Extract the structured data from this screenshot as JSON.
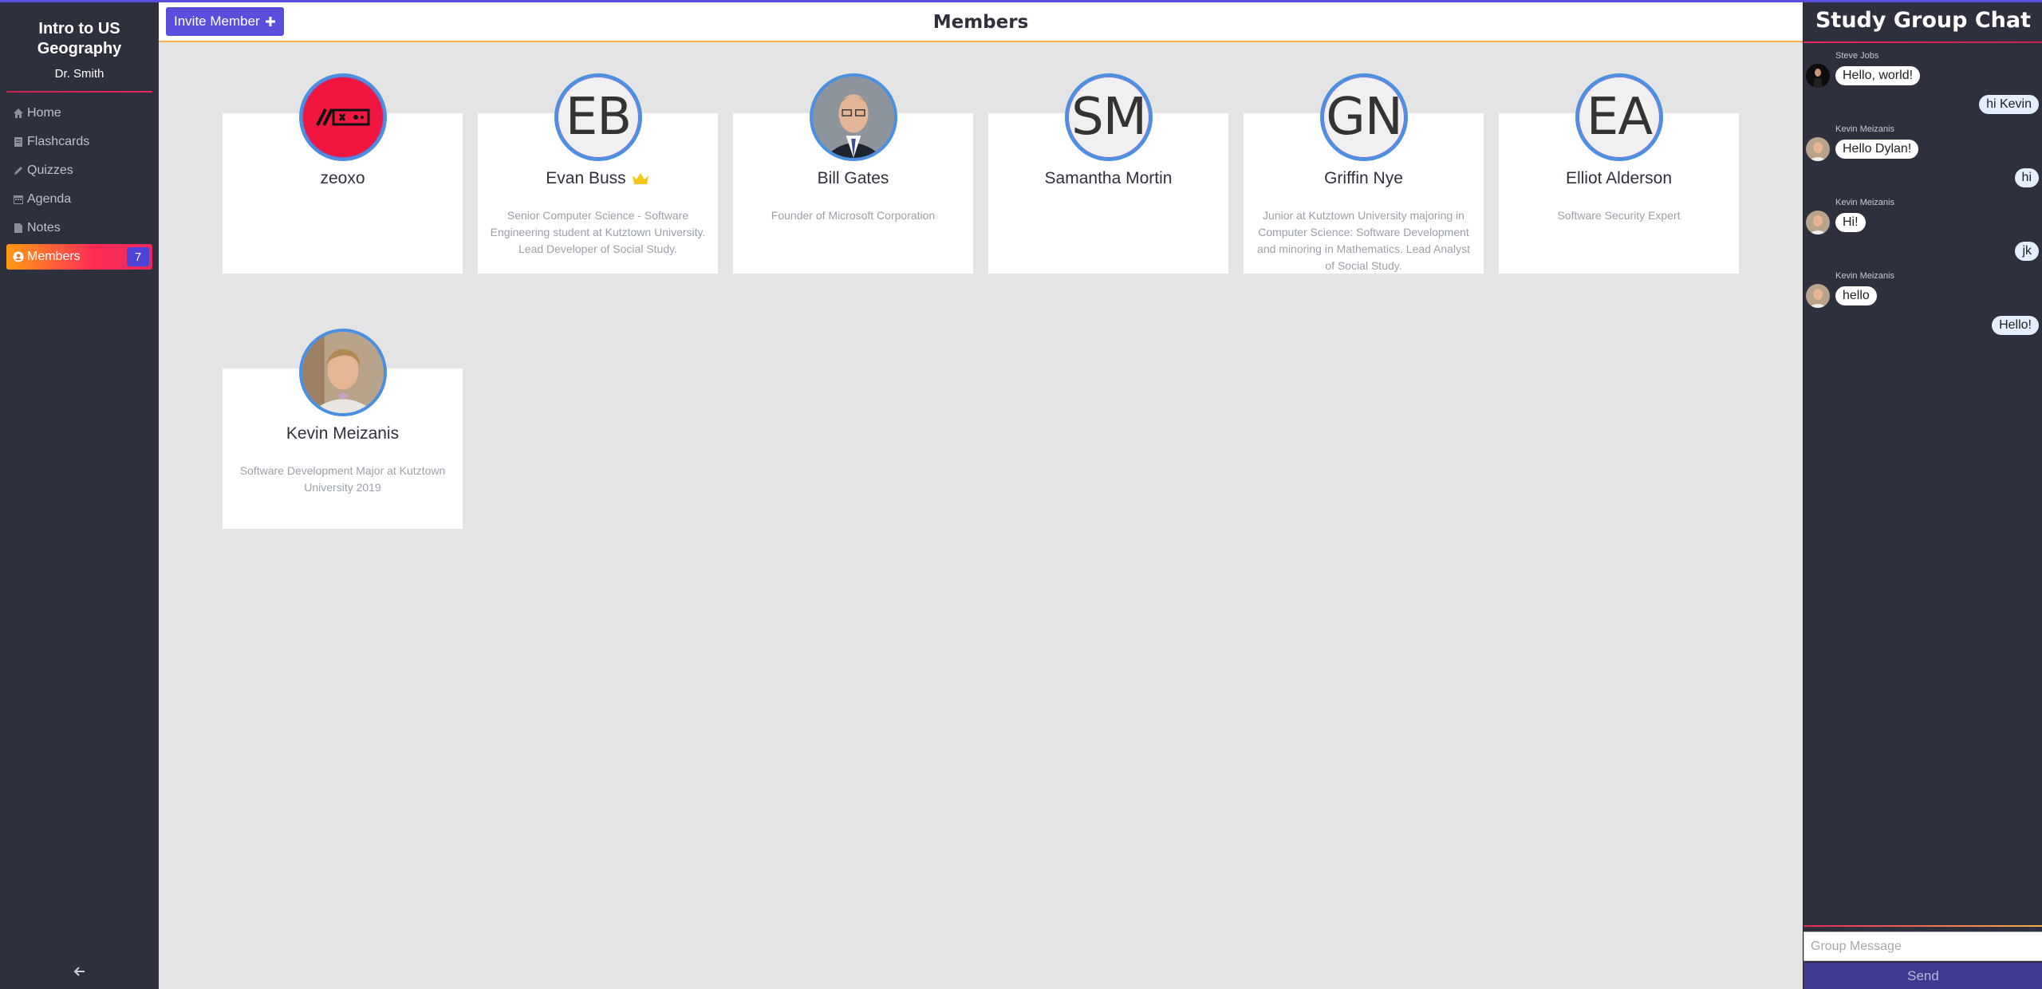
{
  "sidebar": {
    "course_title": "Intro to US Geography",
    "instructor": "Dr. Smith",
    "items": [
      {
        "label": "Home",
        "icon": "home-icon"
      },
      {
        "label": "Flashcards",
        "icon": "flashcards-icon"
      },
      {
        "label": "Quizzes",
        "icon": "pencil-icon"
      },
      {
        "label": "Agenda",
        "icon": "calendar-icon"
      },
      {
        "label": "Notes",
        "icon": "note-icon"
      },
      {
        "label": "Members",
        "icon": "user-circle-icon",
        "badge": "7",
        "active": true
      }
    ],
    "collapse_icon": "arrow-left-icon"
  },
  "header": {
    "invite_label": "Invite Member",
    "title": "Members"
  },
  "members": [
    {
      "name": "zeoxo",
      "avatar": "image",
      "bio": ""
    },
    {
      "name": "Evan Buss",
      "avatar": "EB",
      "owner": true,
      "bio": "Senior Computer Science - Software Engineering student at Kutztown University. Lead Developer of Social Study."
    },
    {
      "name": "Bill Gates",
      "avatar": "image",
      "bio": "Founder of Microsoft Corporation"
    },
    {
      "name": "Samantha Mortin",
      "avatar": "SM",
      "bio": ""
    },
    {
      "name": "Griffin Nye",
      "avatar": "GN",
      "bio": "Junior at Kutztown University majoring in Computer Science: Software Development and minoring in Mathematics. Lead Analyst of Social Study."
    },
    {
      "name": "Elliot Alderson",
      "avatar": "EA",
      "bio": "Software Security Expert"
    },
    {
      "name": "Kevin Meizanis",
      "avatar": "image",
      "bio": "Software Development Major at Kutztown University 2019"
    }
  ],
  "chat": {
    "title": "Study Group Chat",
    "messages": [
      {
        "author": "Steve Jobs",
        "text": "Hello, world!",
        "side": "left"
      },
      {
        "author": "",
        "text": "hi Kevin",
        "side": "right"
      },
      {
        "author": "Kevin Meizanis",
        "text": "Hello Dylan!",
        "side": "left"
      },
      {
        "author": "",
        "text": "hi",
        "side": "right"
      },
      {
        "author": "Kevin Meizanis",
        "text": "Hi!",
        "side": "left"
      },
      {
        "author": "",
        "text": "jk",
        "side": "right"
      },
      {
        "author": "Kevin Meizanis",
        "text": "hello",
        "side": "left"
      },
      {
        "author": "",
        "text": "Hello!",
        "side": "right"
      }
    ],
    "input_placeholder": "Group Message",
    "send_label": "Send"
  },
  "colors": {
    "accent": "#5a4fdc",
    "sidebar_bg": "#2e313d",
    "active_gradient_start": "#ff9a14",
    "active_gradient_end": "#ff2d55",
    "avatar_ring": "#4a90e2"
  }
}
